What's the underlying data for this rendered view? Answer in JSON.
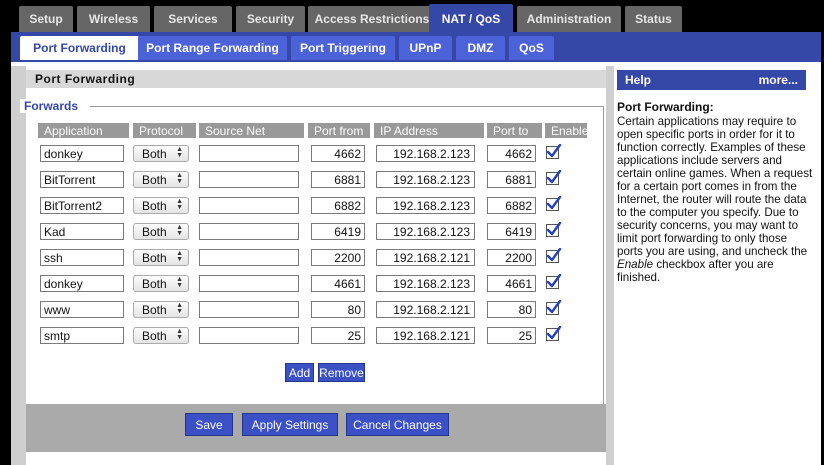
{
  "top_tabs": [
    {
      "label": "Setup"
    },
    {
      "label": "Wireless"
    },
    {
      "label": "Services"
    },
    {
      "label": "Security"
    },
    {
      "label": "Access Restrictions"
    },
    {
      "label": "NAT / QoS",
      "active": true
    },
    {
      "label": "Administration"
    },
    {
      "label": "Status"
    }
  ],
  "sub_tabs": [
    {
      "label": "Port Forwarding",
      "active": true
    },
    {
      "label": "Port Range Forwarding"
    },
    {
      "label": "Port Triggering"
    },
    {
      "label": "UPnP"
    },
    {
      "label": "DMZ"
    },
    {
      "label": "QoS"
    }
  ],
  "section_title": "Port Forwarding",
  "fieldset_legend": "Forwards",
  "columns": {
    "application": "Application",
    "protocol": "Protocol",
    "source_net": "Source Net",
    "port_from": "Port from",
    "ip_address": "IP Address",
    "port_to": "Port to",
    "enable": "Enable"
  },
  "rows": [
    {
      "application": "donkey",
      "protocol": "Both",
      "source_net": "",
      "port_from": "4662",
      "ip": "192.168.2.123",
      "port_to": "4662",
      "enabled": true
    },
    {
      "application": "BitTorrent",
      "protocol": "Both",
      "source_net": "",
      "port_from": "6881",
      "ip": "192.168.2.123",
      "port_to": "6881",
      "enabled": true
    },
    {
      "application": "BitTorrent2",
      "protocol": "Both",
      "source_net": "",
      "port_from": "6882",
      "ip": "192.168.2.123",
      "port_to": "6882",
      "enabled": true
    },
    {
      "application": "Kad",
      "protocol": "Both",
      "source_net": "",
      "port_from": "6419",
      "ip": "192.168.2.123",
      "port_to": "6419",
      "enabled": true
    },
    {
      "application": "ssh",
      "protocol": "Both",
      "source_net": "",
      "port_from": "2200",
      "ip": "192.168.2.121",
      "port_to": "2200",
      "enabled": true
    },
    {
      "application": "donkey",
      "protocol": "Both",
      "source_net": "",
      "port_from": "4661",
      "ip": "192.168.2.123",
      "port_to": "4661",
      "enabled": true
    },
    {
      "application": "www",
      "protocol": "Both",
      "source_net": "",
      "port_from": "80",
      "ip": "192.168.2.121",
      "port_to": "80",
      "enabled": true
    },
    {
      "application": "smtp",
      "protocol": "Both",
      "source_net": "",
      "port_from": "25",
      "ip": "192.168.2.121",
      "port_to": "25",
      "enabled": true
    }
  ],
  "buttons": {
    "add": "Add",
    "remove": "Remove",
    "save": "Save",
    "apply": "Apply Settings",
    "cancel": "Cancel Changes"
  },
  "help": {
    "header": "Help",
    "more": "more...",
    "title": "Port Forwarding:",
    "body_before": "Certain applications may require to open specific ports in order for it to function correctly. Examples of these applications include servers and certain online games. When a request for a certain port comes in from the Internet, the router will route the data to the computer you specify. Due to security concerns, you may want to limit port forwarding to only those ports you are using, and uncheck the ",
    "body_emphasis": "Enable",
    "body_after": " checkbox after you are finished."
  },
  "colors": {
    "accent": "#3548a8",
    "tab_inactive": "#666666",
    "subtab_inactive": "#4b62d8",
    "button": "#3a50c4",
    "checkmark": "#2240c0"
  }
}
